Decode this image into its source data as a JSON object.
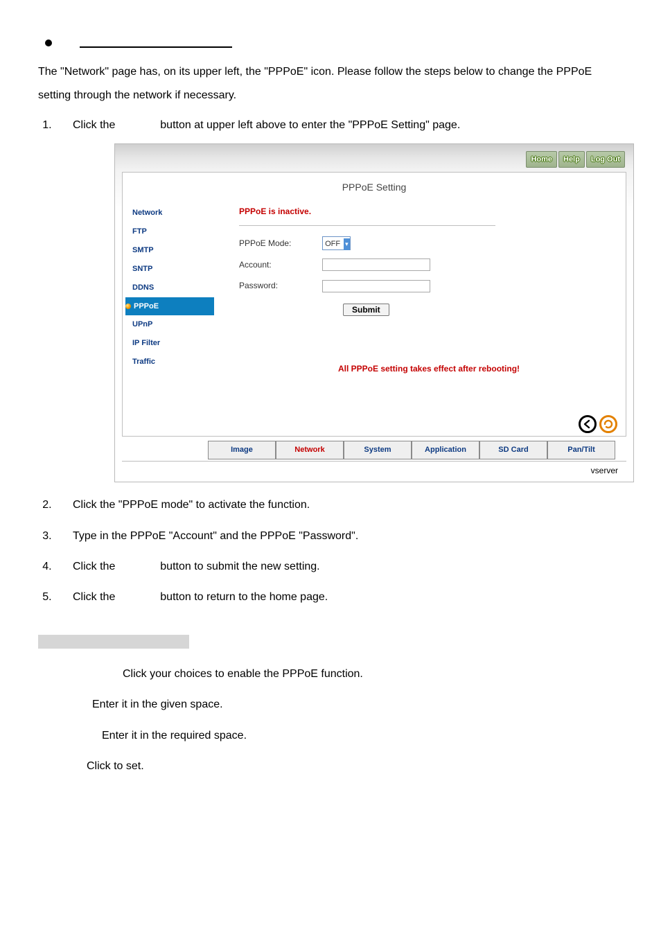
{
  "intro_text": "The \"Network\" page has, on its upper left, the \"PPPoE\" icon. Please follow the steps below to change the PPPoE setting through the network if necessary.",
  "steps": {
    "s1a": "Click the",
    "s1b": "button at upper left above to enter the \"PPPoE Setting\" page.",
    "s2": "Click the \"PPPoE mode\" to activate the function.",
    "s3": "Type in the PPPoE \"Account\" and the PPPoE \"Password\".",
    "s4a": "Click the",
    "s4b": "button to submit the new setting.",
    "s5a": "Click the",
    "s5b": "button to return to the home page."
  },
  "screenshot": {
    "top_buttons": {
      "home": "Home",
      "help": "Help",
      "logout": "Log Out"
    },
    "panel_title": "PPPoE Setting",
    "sidebar": [
      "Network",
      "FTP",
      "SMTP",
      "SNTP",
      "DDNS",
      "PPPoE",
      "UPnP",
      "IP Filter",
      "Traffic"
    ],
    "sidebar_active_index": 5,
    "status": "PPPoE is inactive.",
    "fields": {
      "mode_label": "PPPoE Mode:",
      "mode_value": "OFF",
      "account_label": "Account:",
      "password_label": "Password:"
    },
    "submit": "Submit",
    "warning": "All PPPoE setting takes effect after rebooting!",
    "tabs": [
      "Image",
      "Network",
      "System",
      "Application",
      "SD Card",
      "Pan/Tilt"
    ],
    "tabs_active_index": 1,
    "brand": "vserver"
  },
  "descriptions": {
    "d1": "Click your choices to enable the PPPoE function.",
    "d2": "Enter it in the given space.",
    "d3": "Enter it in the required space.",
    "d4": "Click to set."
  }
}
